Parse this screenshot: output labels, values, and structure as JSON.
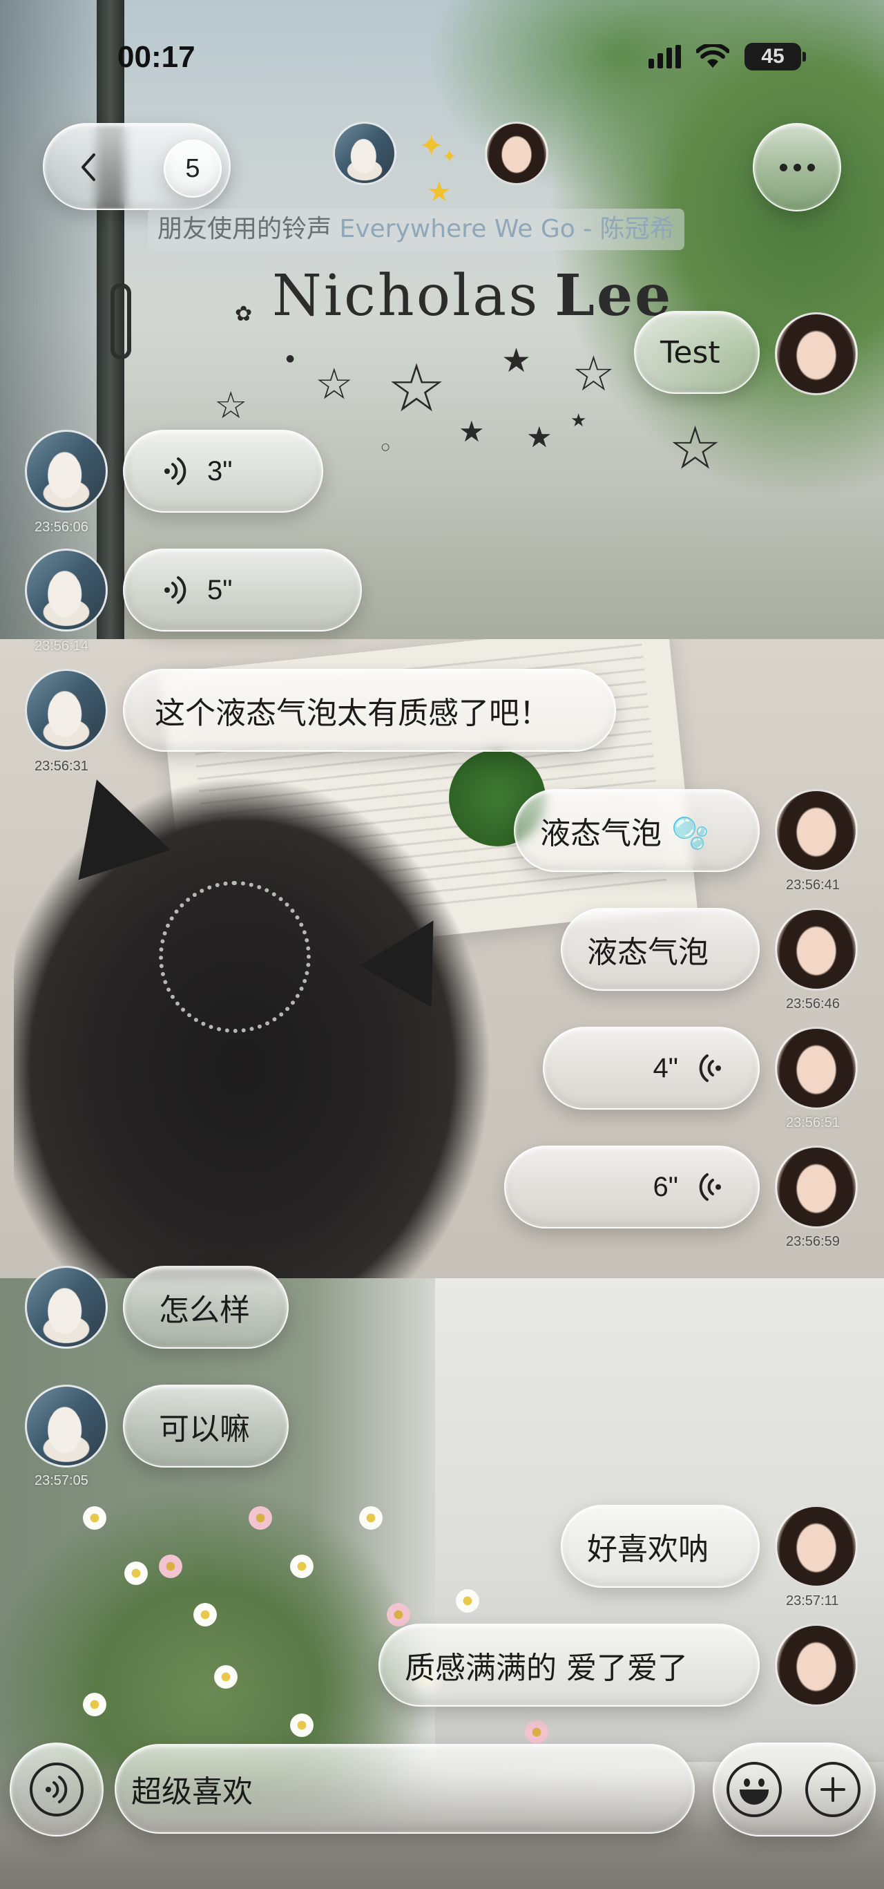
{
  "status_bar": {
    "time": "00:17",
    "battery": "45",
    "icons": [
      "signal-icon",
      "wifi-icon",
      "battery-icon"
    ]
  },
  "header": {
    "unread_count": "5",
    "ringtone_prefix": "朋友使用的铃声",
    "ringtone_song": "Everywhere We Go - 陈冠希",
    "name_first": "Nicholas",
    "name_last": "Lee",
    "icons": [
      "back-chevron-icon",
      "more-icon",
      "sparkle-icon"
    ]
  },
  "messages": [
    {
      "id": "m1",
      "side": "right",
      "type": "text",
      "text": "Test",
      "time": ""
    },
    {
      "id": "m2",
      "side": "left",
      "type": "voice",
      "duration": "3\"",
      "time": "23:56:06"
    },
    {
      "id": "m3",
      "side": "left",
      "type": "voice",
      "duration": "5\"",
      "time": "23:56:14"
    },
    {
      "id": "m4",
      "side": "left",
      "type": "text",
      "text": "这个液态气泡太有质感了吧！",
      "time": "23:56:31"
    },
    {
      "id": "m5",
      "side": "right",
      "type": "text",
      "text": "液态气泡 🫧",
      "time": "23:56:41"
    },
    {
      "id": "m6",
      "side": "right",
      "type": "text",
      "text": "液态气泡",
      "time": "23:56:46"
    },
    {
      "id": "m7",
      "side": "right",
      "type": "voice",
      "duration": "4\"",
      "time": "23:56:51"
    },
    {
      "id": "m8",
      "side": "right",
      "type": "voice",
      "duration": "6\"",
      "time": "23:56:59"
    },
    {
      "id": "m9",
      "side": "left",
      "type": "text",
      "text": "怎么样",
      "time": ""
    },
    {
      "id": "m10",
      "side": "left",
      "type": "text",
      "text": "可以嘛",
      "time": "23:57:05"
    },
    {
      "id": "m11",
      "side": "right",
      "type": "text",
      "text": "好喜欢呐",
      "time": "23:57:11"
    },
    {
      "id": "m12",
      "side": "right",
      "type": "text",
      "text": "质感满满的 爱了爱了",
      "time": ""
    }
  ],
  "input_bar": {
    "value": "超级喜欢",
    "icons": [
      "voice-toggle-icon",
      "emoji-icon",
      "plus-icon"
    ]
  },
  "colors": {
    "ringtone_prefix": "#6a6f70",
    "ringtone_song": "#8fa7bb",
    "text": "#1b1b1b",
    "bubble_glass": "#ffffff"
  }
}
